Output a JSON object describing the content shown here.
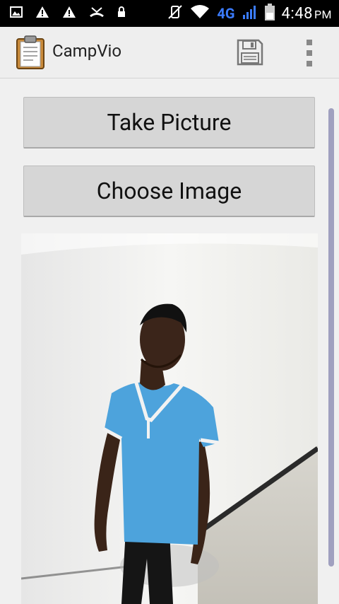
{
  "status_bar": {
    "network": "4G",
    "time": "4:48",
    "ampm": "PM"
  },
  "action_bar": {
    "title": "CampVio",
    "icons": [
      "clipboard-app-icon",
      "save-icon",
      "overflow-menu-icon"
    ]
  },
  "content": {
    "take_picture_label": "Take Picture",
    "choose_image_label": "Choose Image"
  },
  "colors": {
    "status_bar_bg": "#000000",
    "action_bar_bg": "#eeeeee",
    "button_bg": "#d6d6d6",
    "network_accent": "#3b7cff",
    "scrollbar": "#a0a0bf",
    "shirt": "#4da3dc"
  }
}
